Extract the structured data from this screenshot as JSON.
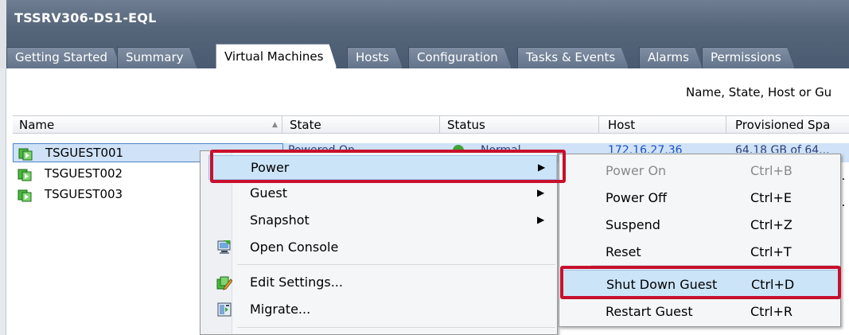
{
  "window": {
    "title": "TSSRV306-DS1-EQL"
  },
  "tabs": [
    {
      "label": "Getting Started",
      "active": false
    },
    {
      "label": "Summary",
      "active": false
    },
    {
      "label": "Virtual Machines",
      "active": true
    },
    {
      "label": "Hosts",
      "active": false
    },
    {
      "label": "Configuration",
      "active": false
    },
    {
      "label": "Tasks & Events",
      "active": false
    },
    {
      "label": "Alarms",
      "active": false
    },
    {
      "label": "Permissions",
      "active": false
    }
  ],
  "filter": {
    "label": "Name, State, Host or Gu"
  },
  "table": {
    "columns": [
      "Name",
      "State",
      "Status",
      "Host",
      "Provisioned Spa"
    ],
    "rows": [
      {
        "name": "TSGUEST001",
        "state": "Powered On",
        "status": "Normal",
        "host": "172.16.27.36",
        "provisioned": "64.18 GB of 64...",
        "selected": true
      },
      {
        "name": "TSGUEST002"
      },
      {
        "name": "TSGUEST003"
      }
    ],
    "truncated_cells": [
      "...",
      "..."
    ]
  },
  "context_menu": {
    "items": [
      {
        "label": "Power",
        "has_submenu": true,
        "icon": "",
        "highlighted": true
      },
      {
        "label": "Guest",
        "has_submenu": true,
        "icon": ""
      },
      {
        "label": "Snapshot",
        "has_submenu": true,
        "icon": ""
      },
      {
        "label": "Open Console",
        "has_submenu": false,
        "icon": "console-icon"
      },
      {
        "label": "Edit Settings...",
        "has_submenu": false,
        "icon": "edit-settings-icon"
      },
      {
        "label": "Migrate...",
        "has_submenu": false,
        "icon": "migrate-icon"
      }
    ]
  },
  "power_submenu": {
    "items": [
      {
        "label": "Power On",
        "shortcut": "Ctrl+B",
        "disabled": true
      },
      {
        "label": "Power Off",
        "shortcut": "Ctrl+E",
        "disabled": false
      },
      {
        "label": "Suspend",
        "shortcut": "Ctrl+Z",
        "disabled": false
      },
      {
        "label": "Reset",
        "shortcut": "Ctrl+T",
        "disabled": false
      },
      {
        "label": "Shut Down Guest",
        "shortcut": "Ctrl+D",
        "disabled": false,
        "highlighted": true
      },
      {
        "label": "Restart Guest",
        "shortcut": "Ctrl+R",
        "disabled": false
      }
    ]
  },
  "colors": {
    "header_bg": "#55657a",
    "selection": "#cfe2f7",
    "menu_highlight": "#cce4f7",
    "annotation_red": "#c8102e",
    "vm_icon_green": "#3fa535"
  }
}
